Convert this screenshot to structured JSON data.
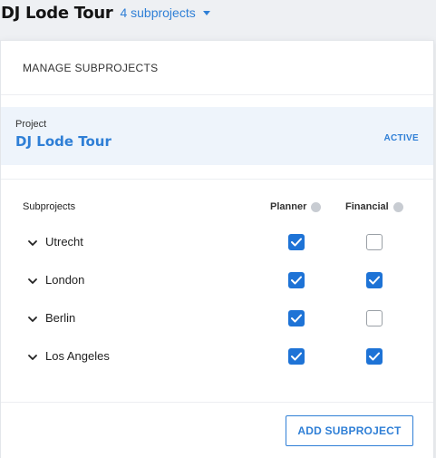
{
  "header": {
    "project_title": "DJ Lode Tour",
    "subprojects_count_label": "4 subprojects"
  },
  "panel": {
    "title": "MANAGE SUBPROJECTS",
    "project_label": "Project",
    "project_name": "DJ Lode Tour",
    "project_status": "ACTIVE",
    "columns": {
      "subprojects": "Subprojects",
      "planner": "Planner",
      "financial": "Financial"
    },
    "rows": [
      {
        "name": "Utrecht",
        "planner": true,
        "financial": false
      },
      {
        "name": "London",
        "planner": true,
        "financial": true
      },
      {
        "name": "Berlin",
        "planner": true,
        "financial": false
      },
      {
        "name": "Los Angeles",
        "planner": true,
        "financial": true
      }
    ],
    "add_button_label": "ADD SUBPROJECT"
  },
  "colors": {
    "accent": "#2f7fd6",
    "checkbox_checked": "#1e73d6",
    "project_card_bg": "#eef4fb"
  },
  "icons": {
    "dropdown": "caret-down-icon",
    "row_expand": "chevron-down-icon",
    "info": "info-dot-icon",
    "check": "check-icon"
  }
}
